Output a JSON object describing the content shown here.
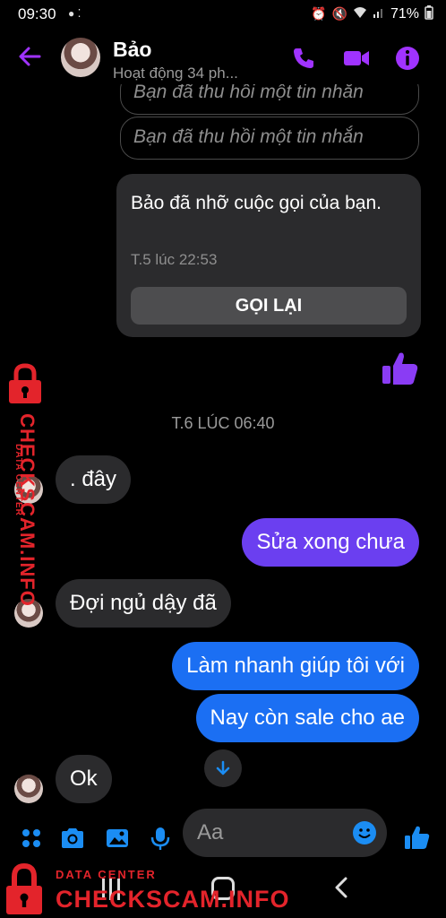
{
  "status_bar": {
    "time": "09:30",
    "battery": "71%"
  },
  "header": {
    "contact_name": "Bảo",
    "activity": "Hoạt động 34 ph..."
  },
  "messages": {
    "recalled_1": "Bạn đã thu hồi một tin nhắn",
    "recalled_2": "Bạn đã thu hồi một tin nhắn",
    "missed_call": {
      "text": "Bảo đã nhỡ cuộc gọi của bạn.",
      "time": "T.5 lúc 22:53",
      "callback_label": "GỌI LẠI"
    },
    "timestamp": "T.6 LÚC 06:40",
    "items": [
      {
        "sender": "them",
        "text": ". đây"
      },
      {
        "sender": "me",
        "text": "Sửa xong chưa"
      },
      {
        "sender": "them",
        "text": "Đợi ngủ dậy đã"
      },
      {
        "sender": "me",
        "text": "Làm nhanh giúp tôi với"
      },
      {
        "sender": "me",
        "text": "Nay còn sale cho ae"
      },
      {
        "sender": "them",
        "text": "Ok"
      }
    ]
  },
  "composer": {
    "placeholder": "Aa"
  },
  "watermark": {
    "vertical_small": "DATA CENTER",
    "vertical_big": "CHECKSCAM.INFO",
    "bottom_small": "DATA CENTER",
    "bottom_big": "CHECKSCAM.INFO"
  },
  "colors": {
    "accent_purple": "#a033ff",
    "sent_purple": "#6b3ff0",
    "sent_blue": "#1b6ff3",
    "received_bg": "#2b2b2d",
    "watermark_red": "#e3242b"
  },
  "icons": [
    "back-arrow-icon",
    "phone-icon",
    "video-icon",
    "info-icon",
    "thumbs-up-icon",
    "menu-dots-icon",
    "camera-icon",
    "image-icon",
    "microphone-icon",
    "emoji-icon",
    "arrow-down-icon",
    "lock-icon"
  ]
}
